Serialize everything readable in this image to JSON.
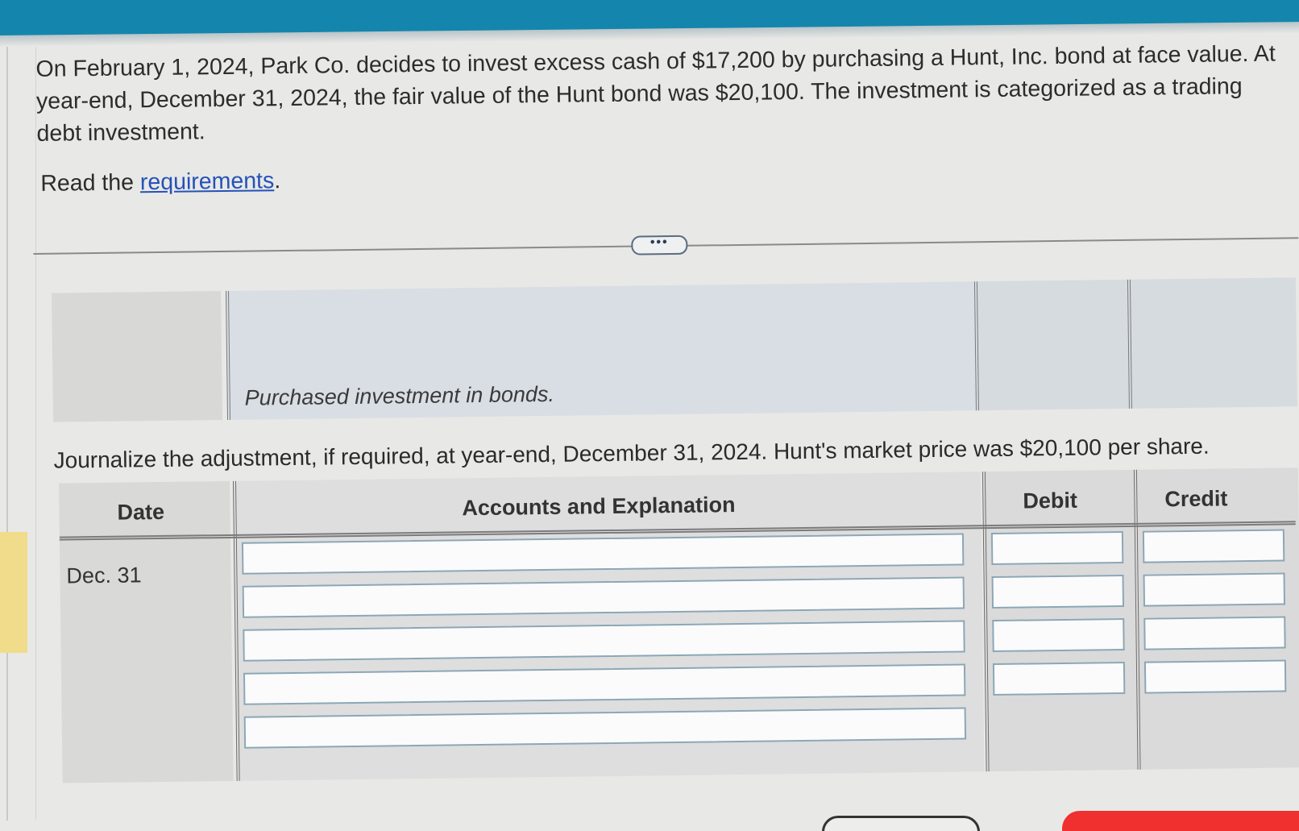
{
  "problem": {
    "text": "On February 1, 2024, Park Co. decides to invest excess cash of $17,200 by purchasing a Hunt, Inc. bond at face value. At year-end, December 31, 2024, the fair value of the Hunt bond was $20,100. The investment is categorized as a trading debt investment.",
    "read_prefix": "Read the ",
    "requirements_link": "requirements",
    "read_suffix": "."
  },
  "expand_button": {
    "label": "•••"
  },
  "previous_entry": {
    "explanation": "Purchased investment in bonds."
  },
  "instruction": "Journalize the adjustment, if required, at year-end, December 31, 2024. Hunt's market price was $20,100 per share.",
  "journal": {
    "headers": {
      "date": "Date",
      "accounts": "Accounts and Explanation",
      "debit": "Debit",
      "credit": "Credit"
    },
    "date_value": "Dec. 31",
    "rows": [
      {
        "account": "",
        "debit": "",
        "credit": ""
      },
      {
        "account": "",
        "debit": "",
        "credit": ""
      },
      {
        "account": "",
        "debit": "",
        "credit": ""
      },
      {
        "account": "",
        "debit": "",
        "credit": ""
      },
      {
        "account": ""
      }
    ]
  },
  "colors": {
    "top_bar": "#1486ad",
    "link": "#2452b8",
    "input_border": "#8ca6b5",
    "action_button": "#f02f2f"
  }
}
